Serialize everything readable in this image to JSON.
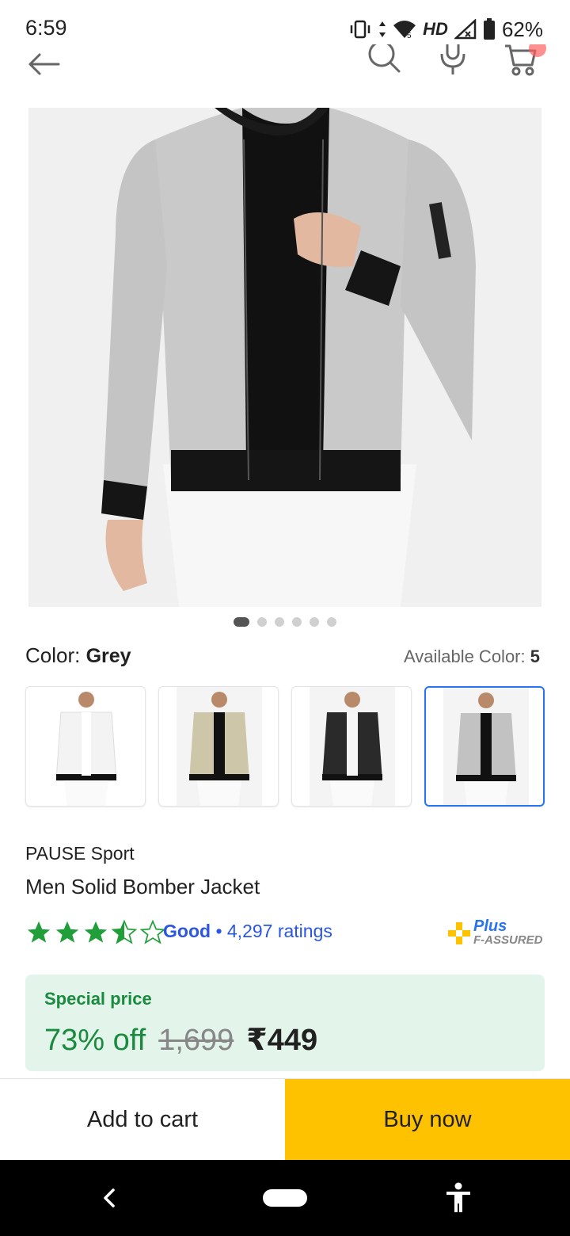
{
  "status_bar": {
    "time": "6:59",
    "network_label": "HD",
    "battery": "62%"
  },
  "top_nav": {
    "icons": [
      "back-arrow-icon",
      "search-icon",
      "mic-icon",
      "cart-icon"
    ]
  },
  "gallery": {
    "image_count": 6,
    "active_index": 0
  },
  "color": {
    "label": "Color:",
    "selected": "Grey",
    "available_label": "Available Color:",
    "available_count": "5",
    "swatches": [
      {
        "name": "White",
        "color": "#f5f5f5"
      },
      {
        "name": "Beige",
        "color": "#c9c2a6"
      },
      {
        "name": "Black",
        "color": "#2b2b2b"
      },
      {
        "name": "Grey",
        "color": "#bdbdbd",
        "selected": true
      }
    ]
  },
  "product": {
    "brand": "PAUSE Sport",
    "title": "Men Solid Bomber Jacket",
    "rating_stars": 3.5,
    "rating_word": "Good",
    "rating_separator": "•",
    "ratings_count": "4,297 ratings",
    "plus_label": "Plus",
    "assured_label": "F-ASSURED"
  },
  "price": {
    "special_label": "Special price",
    "discount": "73% off",
    "mrp": "1,699",
    "final": "₹449"
  },
  "actions": {
    "add_to_cart": "Add to cart",
    "buy_now": "Buy now"
  },
  "colors": {
    "accent_blue": "#2874f0",
    "buy_yellow": "#ffc200",
    "offer_green": "#1a8b3e",
    "star_green": "#1f9e3a"
  }
}
